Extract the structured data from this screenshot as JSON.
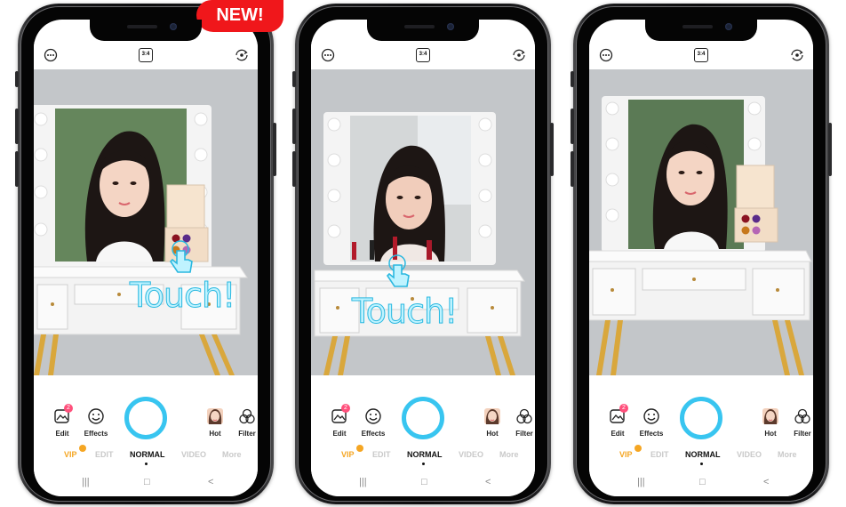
{
  "badge_new": "NEW!",
  "colors": {
    "accent": "#38c5f0",
    "new_badge": "#f0171b",
    "vip": "#f5a623",
    "notification": "#ff4f7b"
  },
  "phones": [
    {
      "top": {
        "left_icon": "more-dots-icon",
        "aspect_label": "3:4",
        "right_icon": "switch-camera-icon"
      },
      "overlay_text": "Touch!",
      "tools": {
        "edit": {
          "label": "Edit",
          "badge": "2"
        },
        "effects": {
          "label": "Effects"
        },
        "hot": {
          "label": "Hot"
        },
        "filter": {
          "label": "Filter"
        }
      },
      "modes": [
        "VIP",
        "EDIT",
        "NORMAL",
        "VIDEO",
        "More"
      ],
      "active_mode": "NORMAL",
      "nav": [
        "|||",
        "□",
        "<"
      ]
    },
    {
      "top": {
        "left_icon": "more-dots-icon",
        "aspect_label": "3:4",
        "right_icon": "switch-camera-icon"
      },
      "overlay_text": "Touch!",
      "tools": {
        "edit": {
          "label": "Edit",
          "badge": "2"
        },
        "effects": {
          "label": "Effects"
        },
        "hot": {
          "label": "Hot"
        },
        "filter": {
          "label": "Filter"
        }
      },
      "modes": [
        "VIP",
        "EDIT",
        "NORMAL",
        "VIDEO",
        "More"
      ],
      "active_mode": "NORMAL",
      "nav": [
        "|||",
        "□",
        "<"
      ]
    },
    {
      "top": {
        "left_icon": "more-dots-icon",
        "aspect_label": "3:4",
        "right_icon": "switch-camera-icon"
      },
      "overlay_text": "",
      "tools": {
        "edit": {
          "label": "Edit",
          "badge": "2"
        },
        "effects": {
          "label": "Effects"
        },
        "hot": {
          "label": "Hot"
        },
        "filter": {
          "label": "Filter"
        }
      },
      "modes": [
        "VIP",
        "EDIT",
        "NORMAL",
        "VIDEO",
        "More"
      ],
      "active_mode": "NORMAL",
      "nav": [
        "|||",
        "□",
        "<"
      ]
    }
  ]
}
